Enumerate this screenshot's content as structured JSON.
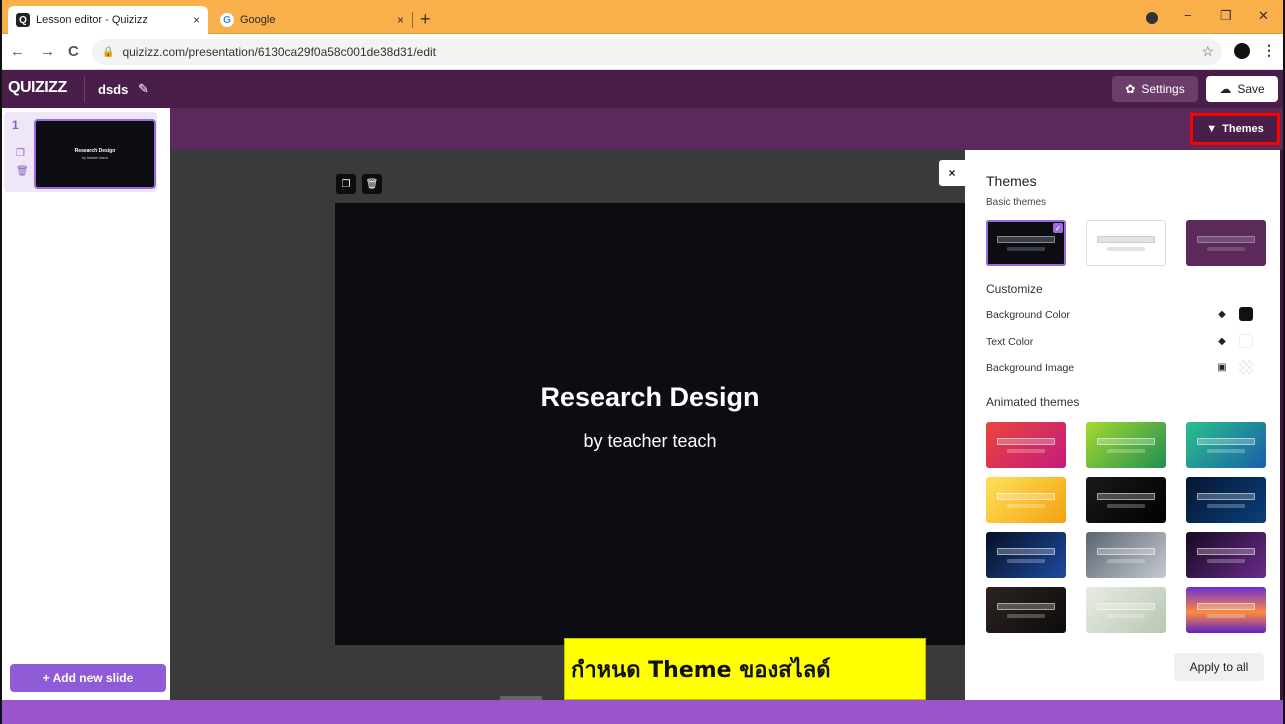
{
  "browser": {
    "tabs": [
      {
        "label": "Lesson editor - Quizizz",
        "favicon": "Q"
      },
      {
        "label": "Google",
        "favicon": "G"
      }
    ],
    "tab_close": "×",
    "new_tab": "+",
    "url": "quizizz.com/presentation/6130ca29f0a58c001de38d31/edit",
    "nav": {
      "back": "←",
      "forward": "→",
      "reload": "C"
    },
    "window": {
      "minimize": "−",
      "restore": "❐",
      "close": "✕"
    }
  },
  "header": {
    "logo": "QUIZIZZ",
    "title": "dsds",
    "edit_icon": "✎",
    "settings_label": "Settings",
    "settings_icon": "✿",
    "save_label": "Save",
    "save_icon": "☁"
  },
  "subheader": {
    "themes_label": "Themes",
    "themes_icon": "▼"
  },
  "slides": [
    {
      "number": "1",
      "title": "Research Design",
      "subtitle": "by teacher teach"
    }
  ],
  "add_slide_label": "+ Add new slide",
  "canvas": {
    "title": "Research Design",
    "subtitle": "by teacher teach",
    "close": "×"
  },
  "themes_panel": {
    "title": "Themes",
    "basic_label": "Basic themes",
    "basic_themes": [
      {
        "name": "dark",
        "bg": "#0b0d12",
        "bar": "#3a3d45",
        "selected": true
      },
      {
        "name": "light",
        "bg": "#ffffff",
        "bar": "#e2e2e2",
        "selected": false
      },
      {
        "name": "purple",
        "bg": "#5b2a5b",
        "bar": "#7a4a7a",
        "selected": false
      }
    ],
    "customize_label": "Customize",
    "background_color_label": "Background Color",
    "text_color_label": "Text Color",
    "background_image_label": "Background Image",
    "animated_label": "Animated themes",
    "animated_themes": [
      {
        "name": "pink-red-gradient",
        "bg": "linear-gradient(135deg,#e9453d,#c51b7a)"
      },
      {
        "name": "lime-green-gradient",
        "bg": "linear-gradient(135deg,#a6d92f,#1f8f52)"
      },
      {
        "name": "teal-blue-gradient",
        "bg": "linear-gradient(135deg,#2ac08b,#1b5fa8)"
      },
      {
        "name": "yellow-gradient",
        "bg": "linear-gradient(135deg,#ffe15a,#f2a20f)"
      },
      {
        "name": "black-lines",
        "bg": "linear-gradient(135deg,#1a1a1a,#000000)"
      },
      {
        "name": "blue-network",
        "bg": "linear-gradient(135deg,#041633,#0a3f7a)"
      },
      {
        "name": "blue-constellation",
        "bg": "linear-gradient(135deg,#061024,#1e4aa0)"
      },
      {
        "name": "grey-mist",
        "bg": "linear-gradient(135deg,#5b6470,#c5cad0)"
      },
      {
        "name": "purple-wave",
        "bg": "linear-gradient(135deg,#150a20,#6a2a8a)"
      },
      {
        "name": "dark-brown",
        "bg": "linear-gradient(135deg,#2b2422,#0e0b0a)"
      },
      {
        "name": "palm-light",
        "bg": "linear-gradient(135deg,#e7ece3,#b9c7b2)"
      },
      {
        "name": "sunset-purple",
        "bg": "linear-gradient(180deg,#6a2fd6,#ff8a3d 55%,#5b23c9)"
      }
    ],
    "apply_label": "Apply to all"
  },
  "caption": "กำหนด Theme ของสไลด์",
  "colors": {
    "quizizz_header": "#4a1e4a",
    "accent": "#8f5bd6",
    "highlight": "#ff0000",
    "caption_bg": "#ffff00"
  }
}
